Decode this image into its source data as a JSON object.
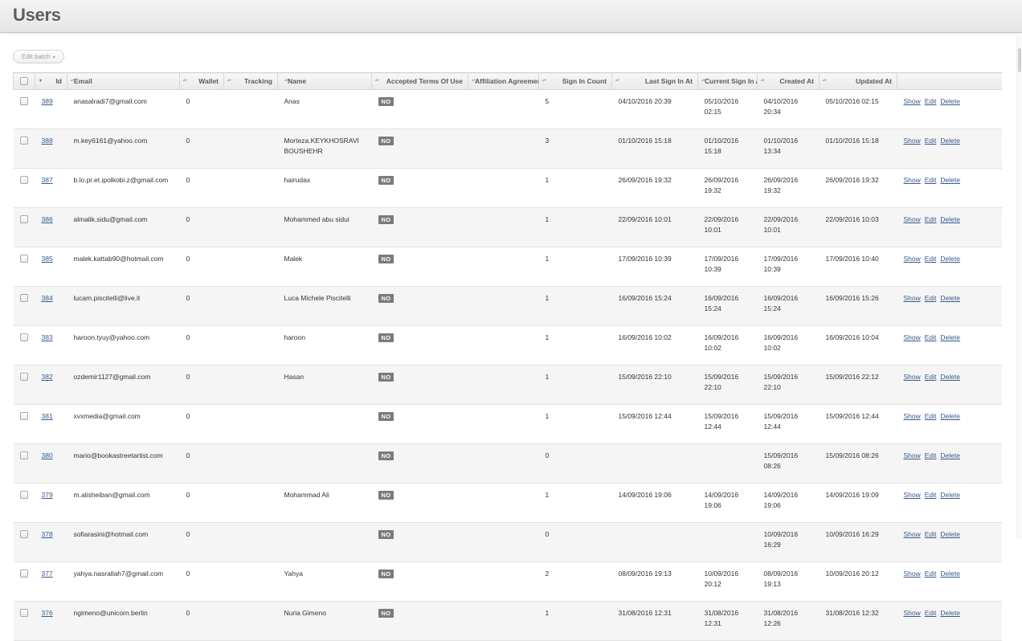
{
  "page": {
    "title": "Users"
  },
  "batch": {
    "label": "Edit batch",
    "caret": "▾"
  },
  "columns": [
    "Id",
    "Email",
    "Wallet",
    "Tracking",
    "Name",
    "Accepted Terms Of Use",
    "Affiliation Agreement",
    "Sign In Count",
    "Last Sign In At",
    "Current Sign In At",
    "Created At",
    "Updated At"
  ],
  "actions": {
    "show": "Show",
    "edit": "Edit",
    "delete": "Delete"
  },
  "rows": [
    {
      "id": "389",
      "email": "anasalradi7@gmail.com",
      "wallet": "0",
      "tracking": "",
      "name": "Anas",
      "terms": "NO",
      "affiliation": "",
      "sign_in_count": "5",
      "last_sign_in": "04/10/2016 20:39",
      "current_sign_in": "05/10/2016 02:15",
      "created": "04/10/2016 20:34",
      "updated": "05/10/2016 02:15"
    },
    {
      "id": "388",
      "email": "m.key6161@yahoo.com",
      "wallet": "0",
      "tracking": "",
      "name": "Morteza.KEYKHOSRAVI BOUSHEHR",
      "terms": "NO",
      "affiliation": "",
      "sign_in_count": "3",
      "last_sign_in": "01/10/2016 15:18",
      "current_sign_in": "01/10/2016 15:18",
      "created": "01/10/2016 13:34",
      "updated": "01/10/2016 15:18"
    },
    {
      "id": "387",
      "email": "b.lo.pr.et.ipolkobi.z@gmail.com",
      "wallet": "0",
      "tracking": "",
      "name": "hairudax",
      "terms": "NO",
      "affiliation": "",
      "sign_in_count": "1",
      "last_sign_in": "26/09/2016 19:32",
      "current_sign_in": "26/09/2016 19:32",
      "created": "26/09/2016 19:32",
      "updated": "26/09/2016 19:32"
    },
    {
      "id": "386",
      "email": "almalik.sidu@gmail.com",
      "wallet": "0",
      "tracking": "",
      "name": "Mohammed abu sidui",
      "terms": "NO",
      "affiliation": "",
      "sign_in_count": "1",
      "last_sign_in": "22/09/2016 10:01",
      "current_sign_in": "22/09/2016 10:01",
      "created": "22/09/2016 10:01",
      "updated": "22/09/2016 10:03"
    },
    {
      "id": "385",
      "email": "malek.kattab90@hotmail.com",
      "wallet": "0",
      "tracking": "",
      "name": "Malek",
      "terms": "NO",
      "affiliation": "",
      "sign_in_count": "1",
      "last_sign_in": "17/09/2016 10:39",
      "current_sign_in": "17/09/2016 10:39",
      "created": "17/09/2016 10:39",
      "updated": "17/09/2016 10:40"
    },
    {
      "id": "384",
      "email": "lucam.piscitelli@live.it",
      "wallet": "0",
      "tracking": "",
      "name": "Luca Michele Piscitelli",
      "terms": "NO",
      "affiliation": "",
      "sign_in_count": "1",
      "last_sign_in": "16/09/2016 15:24",
      "current_sign_in": "16/09/2016 15:24",
      "created": "16/09/2016 15:24",
      "updated": "16/09/2016 15:26"
    },
    {
      "id": "383",
      "email": "haroon.tyuy@yahoo.com",
      "wallet": "0",
      "tracking": "",
      "name": "haroon",
      "terms": "NO",
      "affiliation": "",
      "sign_in_count": "1",
      "last_sign_in": "16/09/2016 10:02",
      "current_sign_in": "16/09/2016 10:02",
      "created": "16/09/2016 10:02",
      "updated": "16/09/2016 10:04"
    },
    {
      "id": "382",
      "email": "ozdemir1127@gmail.com",
      "wallet": "0",
      "tracking": "",
      "name": "Hasan",
      "terms": "NO",
      "affiliation": "",
      "sign_in_count": "1",
      "last_sign_in": "15/09/2016 22:10",
      "current_sign_in": "15/09/2016 22:10",
      "created": "15/09/2016 22:10",
      "updated": "15/09/2016 22:12"
    },
    {
      "id": "381",
      "email": "xvxmedia@gmail.com",
      "wallet": "0",
      "tracking": "",
      "name": "",
      "terms": "NO",
      "affiliation": "",
      "sign_in_count": "1",
      "last_sign_in": "15/09/2016 12:44",
      "current_sign_in": "15/09/2016 12:44",
      "created": "15/09/2016 12:44",
      "updated": "15/09/2016 12:44"
    },
    {
      "id": "380",
      "email": "mario@bookastreetartist.com",
      "wallet": "0",
      "tracking": "",
      "name": "",
      "terms": "NO",
      "affiliation": "",
      "sign_in_count": "0",
      "last_sign_in": "",
      "current_sign_in": "",
      "created": "15/09/2016 08:26",
      "updated": "15/09/2016 08:26"
    },
    {
      "id": "379",
      "email": "m.alisheiban@gmail.com",
      "wallet": "0",
      "tracking": "",
      "name": "Mohammad Ali",
      "terms": "NO",
      "affiliation": "",
      "sign_in_count": "1",
      "last_sign_in": "14/09/2016 19:06",
      "current_sign_in": "14/09/2016 19:06",
      "created": "14/09/2016 19:06",
      "updated": "14/09/2016 19:09"
    },
    {
      "id": "378",
      "email": "sofiarasini@hotmail.com",
      "wallet": "0",
      "tracking": "",
      "name": "",
      "terms": "NO",
      "affiliation": "",
      "sign_in_count": "0",
      "last_sign_in": "",
      "current_sign_in": "",
      "created": "10/09/2016 16:29",
      "updated": "10/09/2016 16:29"
    },
    {
      "id": "377",
      "email": "yahya.nasrallah7@gmail.com",
      "wallet": "0",
      "tracking": "",
      "name": "Yahya",
      "terms": "NO",
      "affiliation": "",
      "sign_in_count": "2",
      "last_sign_in": "08/09/2016 19:13",
      "current_sign_in": "10/09/2016 20:12",
      "created": "08/09/2016 19:13",
      "updated": "10/09/2016 20:12"
    },
    {
      "id": "376",
      "email": "ngimeno@unicorn.berlin",
      "wallet": "0",
      "tracking": "",
      "name": "Nuria Gimeno",
      "terms": "NO",
      "affiliation": "",
      "sign_in_count": "1",
      "last_sign_in": "31/08/2016 12:31",
      "current_sign_in": "31/08/2016 12:31",
      "created": "31/08/2016 12:26",
      "updated": "31/08/2016 12:32"
    }
  ]
}
